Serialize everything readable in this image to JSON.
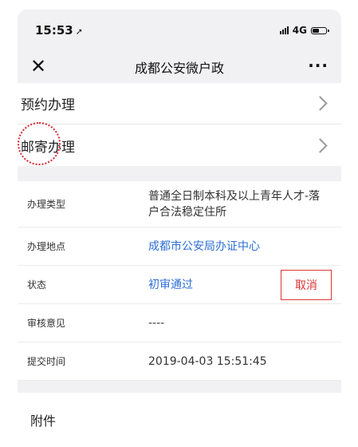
{
  "status_bar": {
    "time": "15:53",
    "location_icon": "location-arrow-icon",
    "network": "4G",
    "signal_icon": "signal-icon",
    "battery_icon": "battery-icon"
  },
  "nav": {
    "close_icon": "close-icon",
    "title": "成都公安微户政",
    "more_icon": "more-icon",
    "more_glyph": "···"
  },
  "menu": {
    "items": [
      {
        "label": "预约办理"
      },
      {
        "label": "邮寄办理"
      }
    ]
  },
  "info": {
    "rows": [
      {
        "label": "办理类型",
        "value": "普通全日制本科及以上青年人才-落户合法稳定住所"
      },
      {
        "label": "办理地点",
        "value": "成都市公安局办证中心"
      },
      {
        "label": "状态",
        "value": "初审通过"
      },
      {
        "label": "审核意见",
        "value": "----"
      },
      {
        "label": "提交时间",
        "value": "2019-04-03 15:51:45"
      }
    ],
    "cancel_label": "取消"
  },
  "attachments": {
    "label": "附件"
  },
  "colors": {
    "link_blue": "#2d6fd6",
    "cancel_red": "#dd3333",
    "annotation_red": "#d8262f",
    "background": "#f1f1f3"
  }
}
